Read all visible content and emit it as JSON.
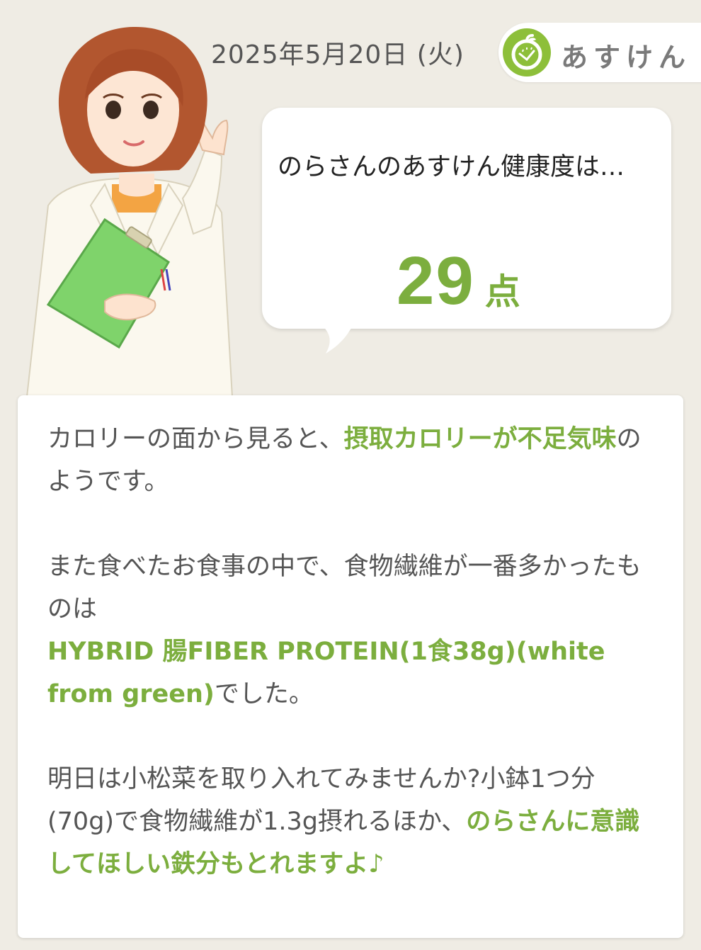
{
  "header": {
    "date": "2025年5月20日 (火)",
    "brand": "あすけん",
    "brand_icon": "apple-scale-icon",
    "accent_color": "#7cae3e"
  },
  "bubble": {
    "intro": "のらさんのあすけん健康度は…",
    "score": "29",
    "score_unit": "点"
  },
  "advice": {
    "p1_pre": "カロリーの面から見ると、",
    "p1_hl": "摂取カロリーが不足気味",
    "p1_post": "のようです。",
    "p2_pre": "また食べたお食事の中で、食物繊維が一番多かったものは",
    "p2_hl": "HYBRID 腸FIBER PROTEIN(1食38g)(white from green)",
    "p2_post": "でした。",
    "p3_pre": "明日は小松菜を取り入れてみませんか?小鉢1つ分(70g)で食物繊維が1.3g摂れるほか、",
    "p3_hl": "のらさんに意識してほしい鉄分もとれますよ♪"
  }
}
